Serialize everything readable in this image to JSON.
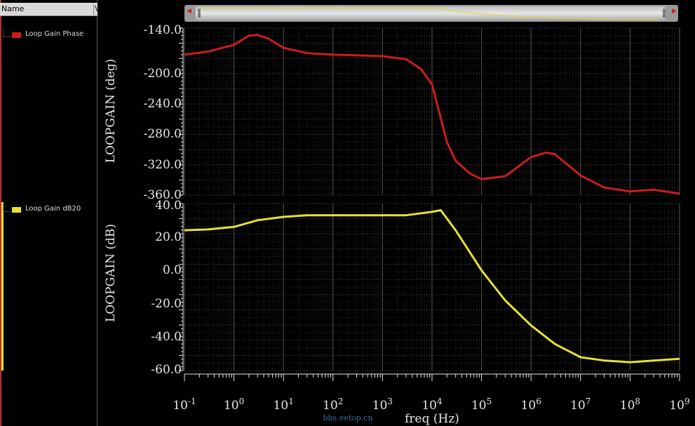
{
  "sidebar": {
    "columns": [
      "Name",
      "V"
    ],
    "legend": [
      {
        "label": "Loop Gain Phase",
        "color": "#cc1c1c"
      },
      {
        "label": "Loop Gain dB20",
        "color": "#e4e233"
      }
    ]
  },
  "chart_data": [
    {
      "type": "line",
      "ylabel": "LOOPGAIN (deg)",
      "yticks": [
        "-140.0",
        "-200.0",
        "-240.0",
        "-280.0",
        "-320.0",
        "-360.0"
      ],
      "ylim": [
        -360,
        -140
      ],
      "xscale": "log",
      "xlim": [
        0.1,
        1000000000
      ],
      "grid": true,
      "series": [
        {
          "name": "Loop Gain Phase",
          "color": "#cc1c1c",
          "x": [
            0.1,
            0.3,
            1,
            2,
            3,
            5,
            10,
            30,
            100,
            300,
            1000,
            3000,
            6000,
            10000,
            20000,
            30000,
            60000,
            100000,
            300000,
            1000000,
            2000000,
            3000000,
            10000000,
            30000000,
            100000000,
            300000000,
            1000000000
          ],
          "y": [
            -175,
            -171,
            -162,
            -150,
            -149,
            -154,
            -166,
            -173,
            -175,
            -176,
            -177,
            -181,
            -194,
            -214,
            -290,
            -315,
            -332,
            -339,
            -335,
            -310,
            -304,
            -306,
            -334,
            -350,
            -355,
            -353,
            -358
          ]
        }
      ]
    },
    {
      "type": "line",
      "xlabel": "freq (Hz)",
      "ylabel": "LOOPGAIN (dB)",
      "yticks": [
        "40.0",
        "20.0",
        "0.0",
        "-20.0",
        "-40.0",
        "-60.0"
      ],
      "ylim": [
        -60,
        40
      ],
      "xscale": "log",
      "xlim": [
        0.1,
        1000000000
      ],
      "xticks": [
        "0.1",
        "1",
        "10",
        "100",
        "1000",
        "10000",
        "100000",
        "1000000",
        "10000000",
        "100000000",
        "1000000000"
      ],
      "grid": true,
      "series": [
        {
          "name": "Loop Gain dB20",
          "color": "#e4e233",
          "x": [
            0.1,
            0.3,
            1,
            3,
            10,
            30,
            100,
            1000,
            3000,
            10000,
            15000,
            20000,
            30000,
            100000,
            300000,
            1000000,
            3000000,
            10000000,
            30000000,
            100000000,
            300000000,
            1000000000
          ],
          "y": [
            24,
            24.5,
            26,
            30,
            32,
            33,
            33,
            33,
            33,
            35,
            36,
            31,
            24,
            0,
            -18,
            -33,
            -44,
            -52,
            -54,
            -55,
            -54,
            -53
          ]
        }
      ]
    }
  ],
  "x_tick_labels": [
    {
      "base": "10",
      "exp": "-1"
    },
    {
      "base": "10",
      "exp": "0"
    },
    {
      "base": "10",
      "exp": "1"
    },
    {
      "base": "10",
      "exp": "2"
    },
    {
      "base": "10",
      "exp": "3"
    },
    {
      "base": "10",
      "exp": "4"
    },
    {
      "base": "10",
      "exp": "5"
    },
    {
      "base": "10",
      "exp": "6"
    },
    {
      "base": "10",
      "exp": "7"
    },
    {
      "base": "10",
      "exp": "8"
    },
    {
      "base": "10",
      "exp": "9"
    }
  ],
  "watermark": "bbs.eetop.cn",
  "colors": {
    "background": "#000000",
    "grid": "#5a5a5a",
    "axis_text": "#e6e6e6"
  }
}
